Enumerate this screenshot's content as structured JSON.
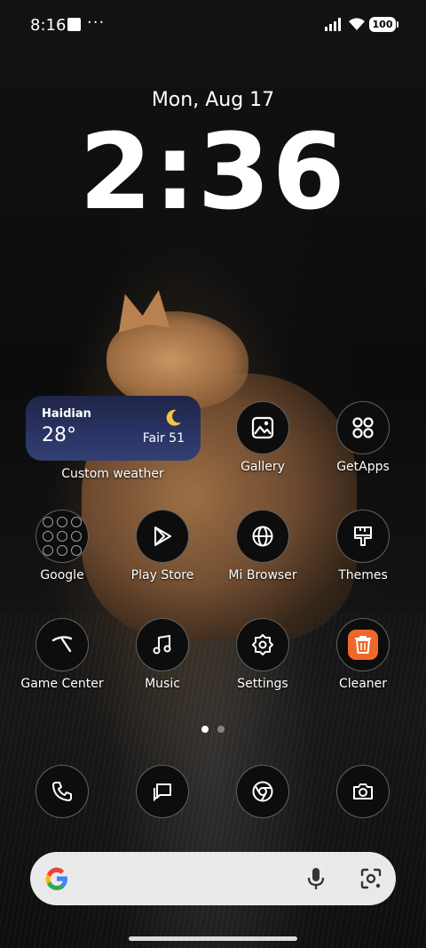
{
  "status_bar": {
    "time": "8:16",
    "dots": "···",
    "battery": "100"
  },
  "lock": {
    "date": "Mon, Aug 17",
    "time": "2:36"
  },
  "weather": {
    "city": "Haidian",
    "temperature": "28°",
    "condition": "Fair 51",
    "label": "Custom weather"
  },
  "apps": {
    "gallery": "Gallery",
    "getapps": "GetApps",
    "google": "Google",
    "playstore": "Play Store",
    "browser": "Mi Browser",
    "themes": "Themes",
    "gamecenter": "Game Center",
    "music": "Music",
    "settings": "Settings",
    "cleaner": "Cleaner"
  },
  "dock": [
    "phone-icon",
    "messages-icon",
    "chrome-icon",
    "camera-icon"
  ],
  "pages": {
    "count": 2,
    "current": 1
  },
  "search_bar": {
    "icons": [
      "google-g-icon",
      "mic-icon",
      "lens-icon"
    ]
  }
}
